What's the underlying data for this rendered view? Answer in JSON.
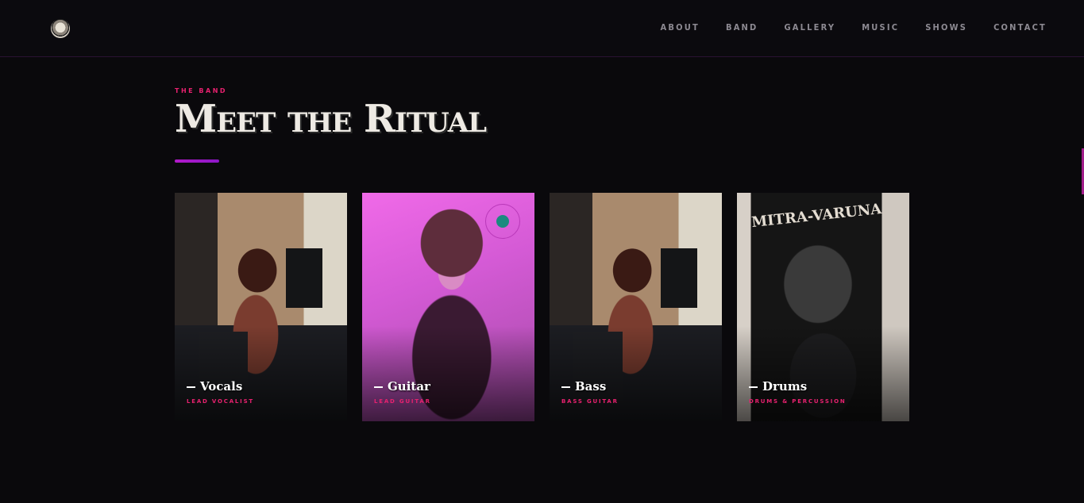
{
  "nav": {
    "items": [
      "ABOUT",
      "BAND",
      "GALLERY",
      "MUSIC",
      "SHOWS",
      "CONTACT"
    ]
  },
  "hero": {
    "eyebrow": "THE BAND",
    "title": "Meet the Ritual"
  },
  "cards": [
    {
      "role": "Vocals",
      "subtitle": "LEAD VOCALIST",
      "photo": "vocal-photo"
    },
    {
      "role": "Guitar",
      "subtitle": "LEAD GUITAR",
      "photo": "guitar-photo"
    },
    {
      "role": "Bass",
      "subtitle": "BASS GUITAR",
      "photo": "vocal-photo"
    },
    {
      "role": "Drums",
      "subtitle": "DRUMS & PERCUSSION",
      "photo": "drums-photo",
      "banner": "MITRA-VARUNA"
    }
  ],
  "colors": {
    "accent": "#e8216f",
    "underline": "#b219c9",
    "background": "#0a090c"
  }
}
